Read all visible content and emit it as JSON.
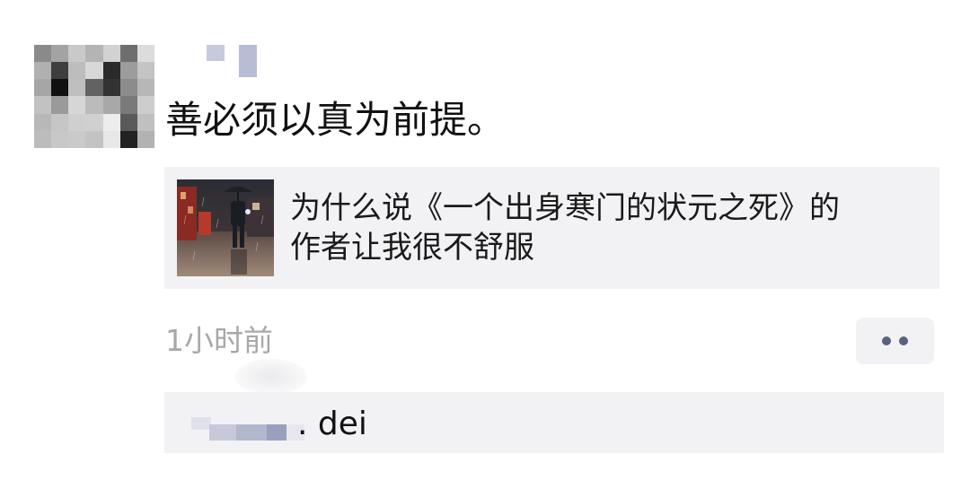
{
  "post": {
    "text": "善必须以真为前提。",
    "timestamp": "1小时前"
  },
  "link": {
    "title_line1": "为什么说《一个出身寒门的状元之死》的",
    "title_line2": "作者让我很不舒服"
  },
  "comments": [
    {
      "text": ". dei"
    }
  ],
  "icons": {
    "more": "more-dots-icon",
    "thumbnail": "rainy-street-umbrella-thumbnail"
  },
  "colors": {
    "card_bg": "#f2f2f5",
    "timestamp": "#a8a8a8",
    "more_dots": "#58647e"
  }
}
